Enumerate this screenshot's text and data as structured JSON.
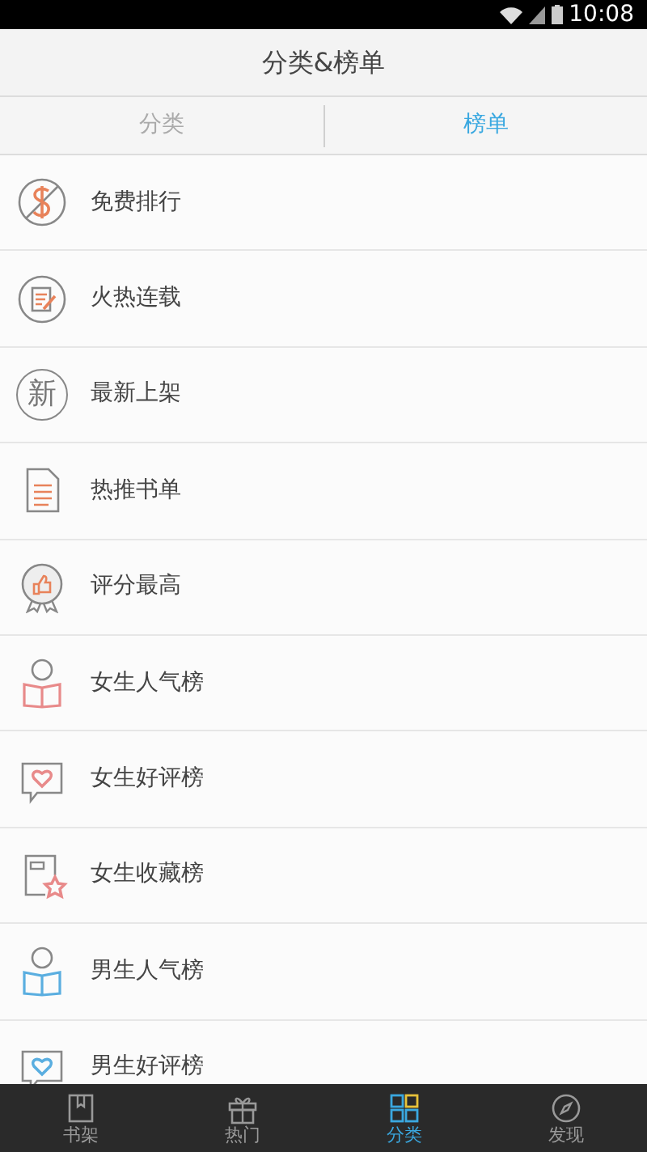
{
  "status_bar": {
    "time": "10:08"
  },
  "header": {
    "title": "分类&榜单"
  },
  "tabs": [
    {
      "label": "分类",
      "selected": false
    },
    {
      "label": "榜单",
      "selected": true
    }
  ],
  "items": [
    {
      "label": "免费排行",
      "kind": "free"
    },
    {
      "label": "火热连载",
      "kind": "serial"
    },
    {
      "label": "最新上架",
      "kind": "glyph",
      "glyph": "新"
    },
    {
      "label": "热推书单",
      "kind": "document"
    },
    {
      "label": "评分最高",
      "kind": "award"
    },
    {
      "label": "女生人气榜",
      "kind": "reader",
      "color": "#e88a8a"
    },
    {
      "label": "女生好评榜",
      "kind": "heart",
      "color": "#e88a8a"
    },
    {
      "label": "女生收藏榜",
      "kind": "star",
      "color": "#e88a8a"
    },
    {
      "label": "男生人气榜",
      "kind": "reader",
      "color": "#5aaee0"
    },
    {
      "label": "男生好评榜",
      "kind": "heart",
      "color": "#5aaee0"
    }
  ],
  "bottom_nav": [
    {
      "label": "书架",
      "kind": "book",
      "selected": false
    },
    {
      "label": "热门",
      "kind": "gift",
      "selected": false
    },
    {
      "label": "分类",
      "kind": "grid",
      "selected": true
    },
    {
      "label": "发现",
      "kind": "compass",
      "selected": false
    }
  ]
}
